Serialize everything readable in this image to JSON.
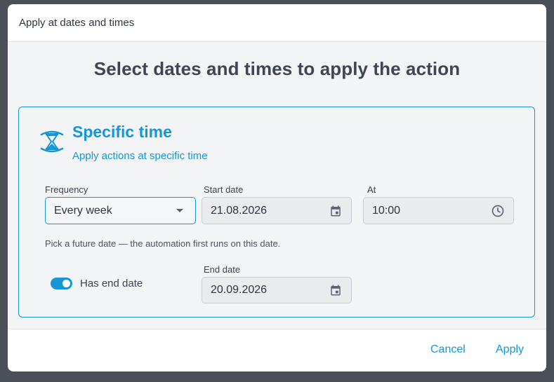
{
  "dialog": {
    "title": "Apply at dates and times",
    "heading": "Select dates and times to apply the action",
    "cancel_label": "Cancel",
    "apply_label": "Apply"
  },
  "card": {
    "icon": "hourglass-icon",
    "title": "Specific time",
    "subtitle": "Apply actions at specific time",
    "frequency": {
      "label": "Frequency",
      "value": "Every week",
      "icon": "chevron-down-icon"
    },
    "start_date": {
      "label": "Start date",
      "value": "21.08.2026",
      "icon": "calendar-icon"
    },
    "at": {
      "label": "At",
      "value": "10:00",
      "icon": "clock-icon"
    },
    "hint": "Pick a future date — the automation first runs on this date.",
    "end_toggle": {
      "label": "Has end date",
      "on": true
    },
    "end_date": {
      "label": "End date",
      "value": "20.09.2026",
      "icon": "calendar-icon"
    }
  },
  "colors": {
    "accent": "#1596d6",
    "overlay": "#4a4f58",
    "body_bg": "#f3f4f6"
  }
}
